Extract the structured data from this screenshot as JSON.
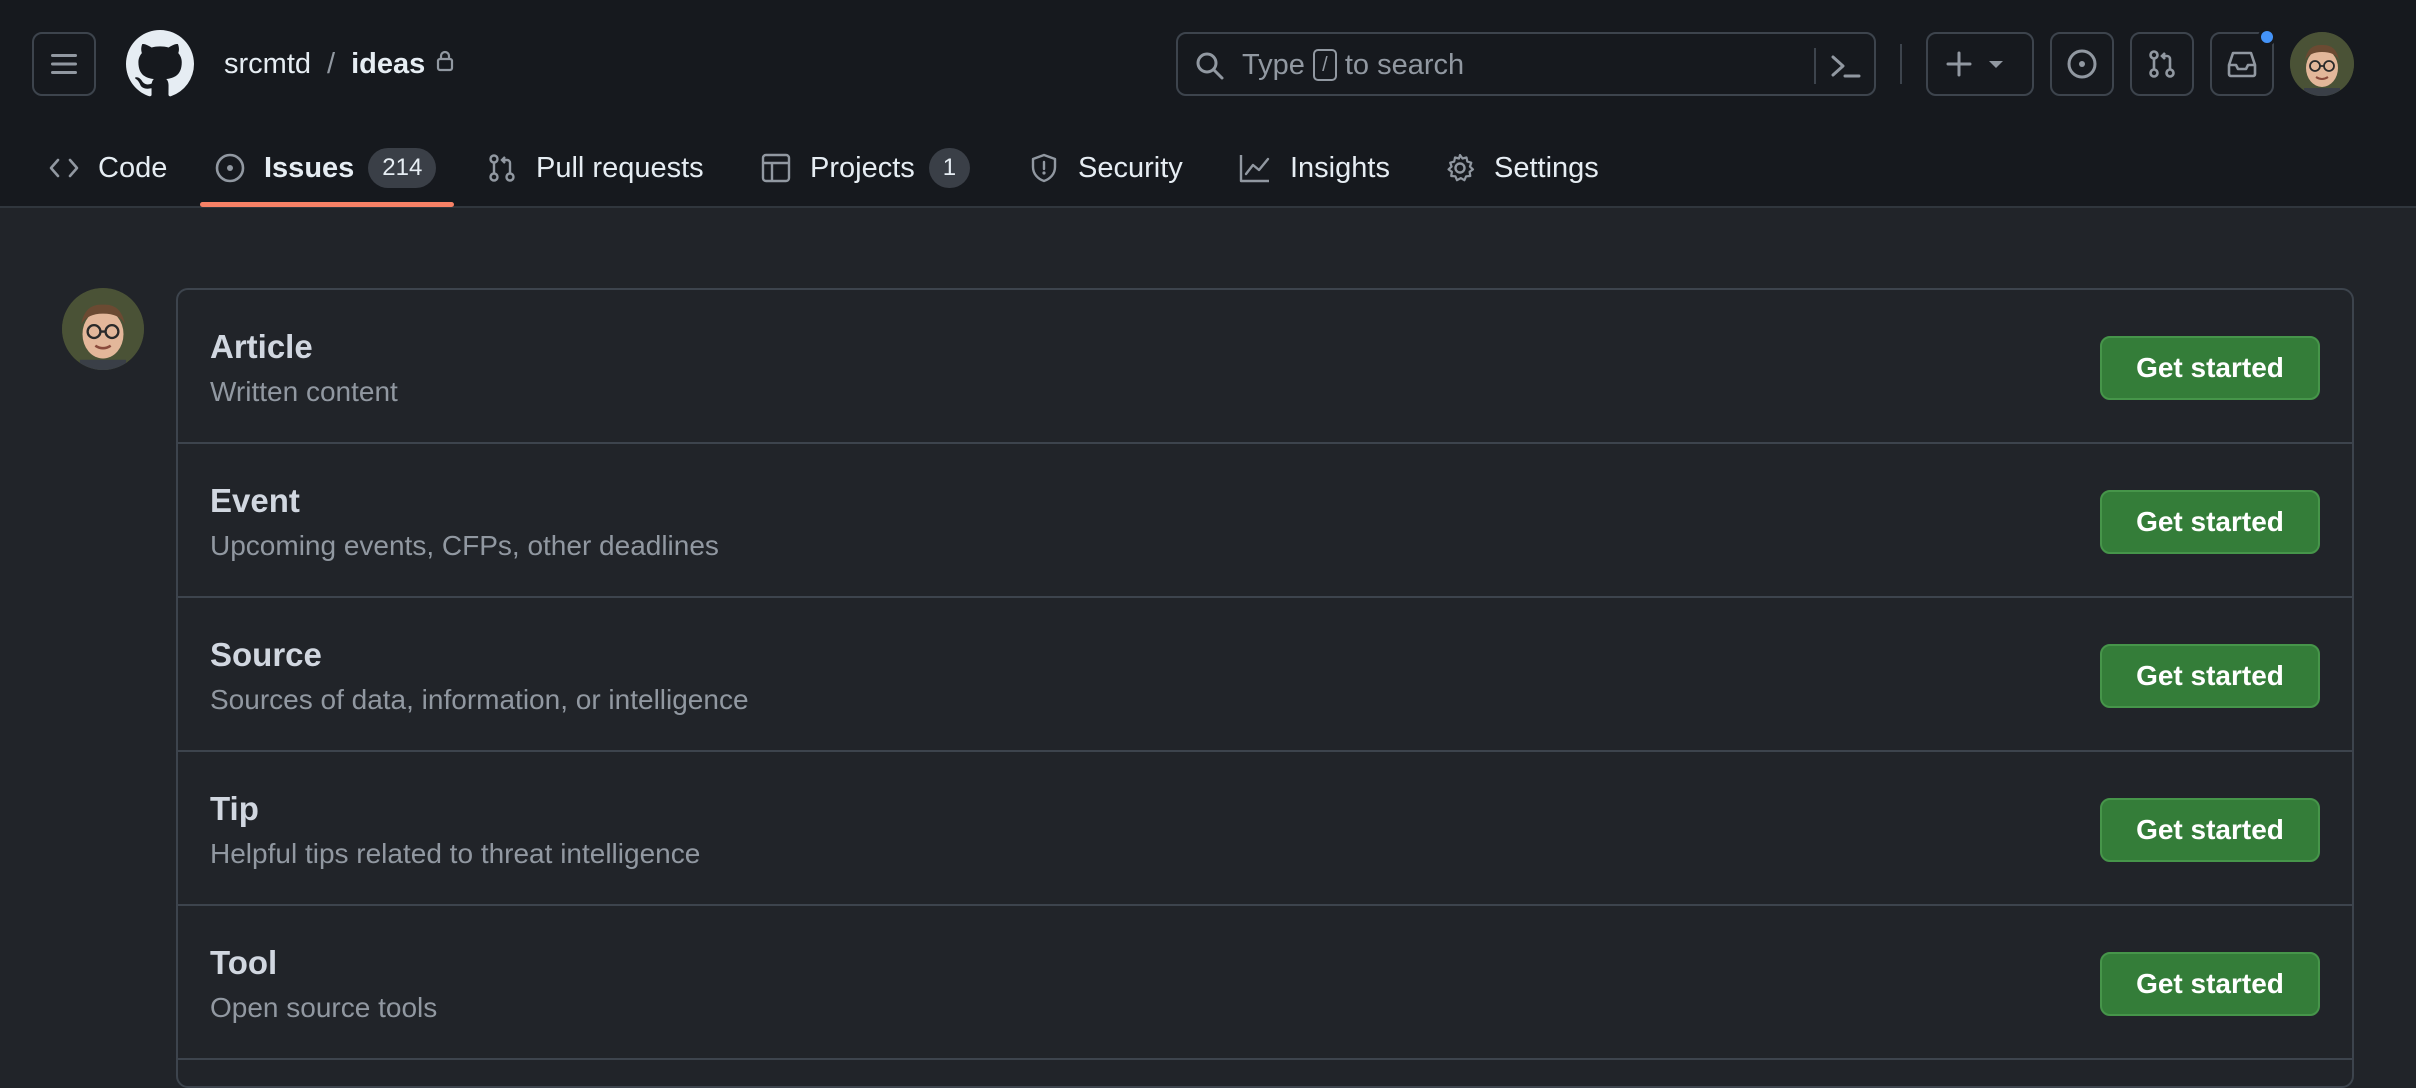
{
  "header": {
    "owner": "srcmtd",
    "separator": "/",
    "repo": "ideas",
    "search": {
      "prefix": "Type",
      "key": "/",
      "suffix": "to search"
    }
  },
  "tabs": [
    {
      "label": "Code",
      "icon": "code-icon"
    },
    {
      "label": "Issues",
      "icon": "issue-opened-icon",
      "count": "214",
      "active": true
    },
    {
      "label": "Pull requests",
      "icon": "git-pull-request-icon"
    },
    {
      "label": "Projects",
      "icon": "table-icon",
      "count": "1"
    },
    {
      "label": "Security",
      "icon": "shield-icon"
    },
    {
      "label": "Insights",
      "icon": "graph-icon"
    },
    {
      "label": "Settings",
      "icon": "gear-icon"
    }
  ],
  "templates": [
    {
      "title": "Article",
      "description": "Written content",
      "button": "Get started"
    },
    {
      "title": "Event",
      "description": "Upcoming events, CFPs, other deadlines",
      "button": "Get started"
    },
    {
      "title": "Source",
      "description": "Sources of data, information, or intelligence",
      "button": "Get started"
    },
    {
      "title": "Tip",
      "description": "Helpful tips related to threat intelligence",
      "button": "Get started"
    },
    {
      "title": "Tool",
      "description": "Open source tools",
      "button": "Get started"
    }
  ],
  "colors": {
    "accent_underline": "#f78166",
    "primary_button": "#347d39",
    "notification_dot": "#4493f8"
  }
}
